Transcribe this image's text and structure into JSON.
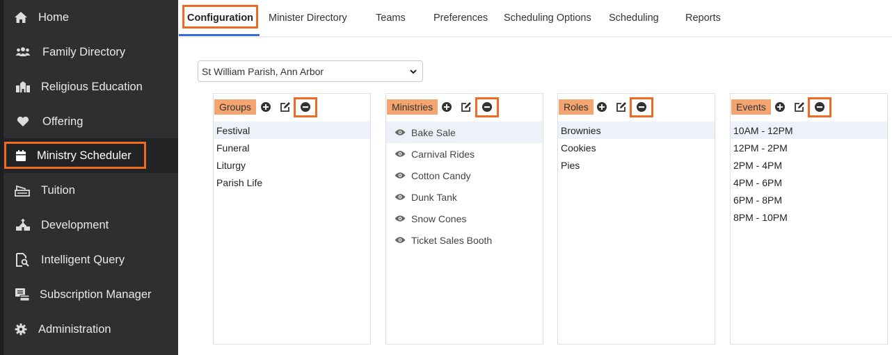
{
  "sidebar": {
    "items": [
      {
        "label": "Home",
        "icon": "home-icon"
      },
      {
        "label": "Family Directory",
        "icon": "users-icon"
      },
      {
        "label": "Religious Education",
        "icon": "school-icon"
      },
      {
        "label": "Offering",
        "icon": "heart-icon"
      },
      {
        "label": "Ministry Scheduler",
        "icon": "calendar-icon"
      },
      {
        "label": "Tuition",
        "icon": "tuition-icon"
      },
      {
        "label": "Development",
        "icon": "church-icon"
      },
      {
        "label": "Intelligent Query",
        "icon": "query-icon"
      },
      {
        "label": "Subscription Manager",
        "icon": "subscription-icon"
      },
      {
        "label": "Administration",
        "icon": "gear-icon"
      }
    ],
    "active": "Ministry Scheduler"
  },
  "tabs": [
    "Configuration",
    "Minister Directory",
    "Teams",
    "Preferences",
    "Scheduling Options",
    "Scheduling",
    "Reports"
  ],
  "active_tab": "Configuration",
  "parish_select": {
    "value": "St William Parish, Ann Arbor"
  },
  "panels": {
    "groups": {
      "title": "Groups",
      "items": [
        "Festival",
        "Funeral",
        "Liturgy",
        "Parish Life"
      ],
      "selected": "Festival"
    },
    "ministries": {
      "title": "Ministries",
      "items": [
        "Bake Sale",
        "Carnival Rides",
        "Cotton Candy",
        "Dunk Tank",
        "Snow Cones",
        "Ticket Sales Booth"
      ],
      "selected": "Bake Sale"
    },
    "roles": {
      "title": "Roles",
      "items": [
        "Brownies",
        "Cookies",
        "Pies"
      ],
      "selected": "Brownies"
    },
    "events": {
      "title": "Events",
      "items": [
        "10AM - 12PM",
        "12PM - 2PM",
        "2PM - 4PM",
        "4PM - 6PM",
        "6PM - 8PM",
        "8PM - 10PM"
      ],
      "selected": "10AM - 12PM"
    }
  },
  "colors": {
    "sidebar_bg": "#2e2f30",
    "highlight": "#f26a21",
    "panel_title_bg": "#f4a46f",
    "tab_underline": "#3b6bd6"
  }
}
